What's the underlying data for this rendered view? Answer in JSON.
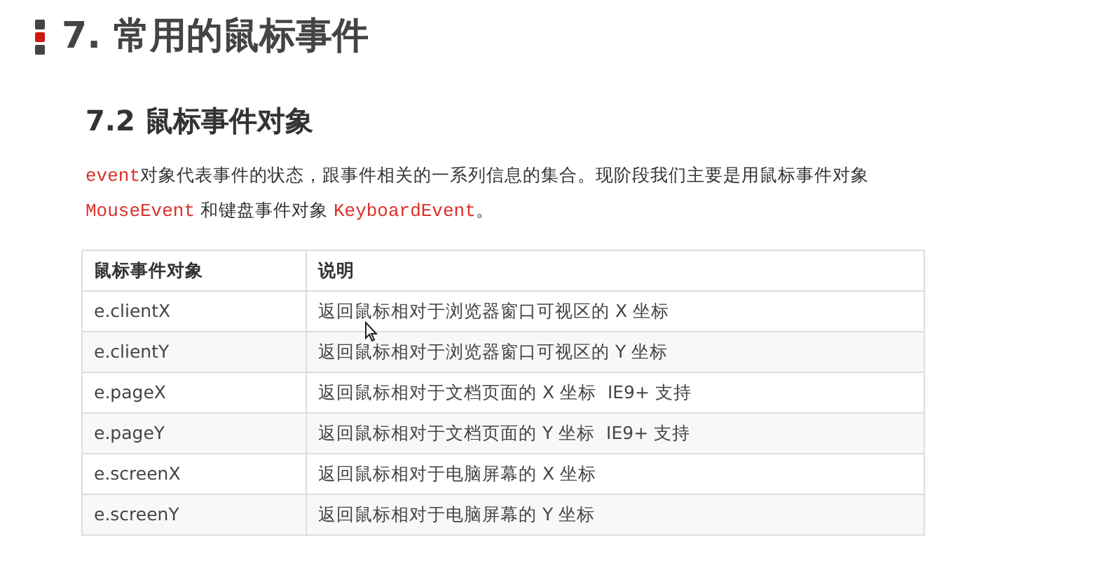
{
  "title": "7. 常用的鼠标事件",
  "subtitle": "7.2 鼠标事件对象",
  "intro_lines": [
    [
      {
        "kind": "code",
        "text": "event"
      },
      {
        "kind": "text",
        "text": "对象代表事件的状态，跟事件相关的一系列信息的集合。现阶段我们主要是用鼠标事件对象"
      }
    ],
    [
      {
        "kind": "code",
        "text": "MouseEvent"
      },
      {
        "kind": "text",
        "text": " 和键盘事件对象 "
      },
      {
        "kind": "code",
        "text": "KeyboardEvent"
      },
      {
        "kind": "text",
        "text": "。"
      }
    ]
  ],
  "table": {
    "columns": [
      "鼠标事件对象",
      "说明"
    ],
    "rows": [
      [
        "e.clientX",
        "返回鼠标相对于浏览器窗口可视区的 X 坐标"
      ],
      [
        "e.clientY",
        "返回鼠标相对于浏览器窗口可视区的 Y 坐标"
      ],
      [
        "e.pageX",
        "返回鼠标相对于文档页面的 X 坐标  IE9+ 支持"
      ],
      [
        "e.pageY",
        "返回鼠标相对于文档页面的 Y 坐标  IE9+ 支持"
      ],
      [
        "e.screenX",
        "返回鼠标相对于电脑屏幕的 X 坐标"
      ],
      [
        "e.screenY",
        "返回鼠标相对于电脑屏幕的 Y 坐标"
      ]
    ]
  }
}
